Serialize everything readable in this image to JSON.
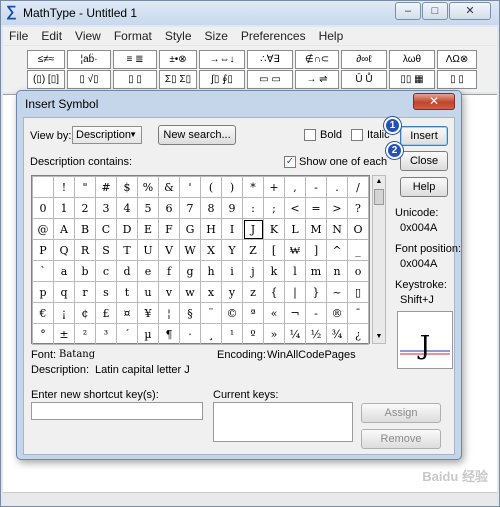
{
  "app": {
    "title": "MathType - Untitled 1",
    "window_buttons": {
      "minimize": "–",
      "maximize": "□",
      "close": "✕"
    },
    "menu": [
      "File",
      "Edit",
      "View",
      "Format",
      "Style",
      "Size",
      "Preferences",
      "Help"
    ],
    "toolbar_row1": [
      "≤≠≈",
      "¦ab̈·",
      "≡ ≣",
      "±•⊗",
      "→⇔↓",
      "∴∀∃",
      "∉∩⊂",
      "∂∞ℓ",
      "λωθ",
      "ΛΩ⊗"
    ],
    "toolbar_row2": [
      "(▯) [▯]",
      "▯ √▯",
      "▯ ▯",
      "Σ▯ Σ▯",
      "∫▯ ∮▯",
      "▭ ▭",
      "→ ⇌",
      "Ū Ů",
      "▯▯ ▦",
      "▯ ▯"
    ]
  },
  "dialog": {
    "title": "Insert Symbol",
    "close_label": "✕",
    "view_by_label": "View by:",
    "view_by_value": "Description",
    "new_search_label": "New search...",
    "bold_label": "Bold",
    "italic_label": "Italic",
    "insert_label": "Insert",
    "close_button_label": "Close",
    "help_label": "Help",
    "description_contains_label": "Description contains:",
    "show_one_label": "Show one of each",
    "show_one_checked": "✓",
    "step_badges": [
      "1",
      "2"
    ],
    "symbols": [
      [
        " ",
        "!",
        "\"",
        "#",
        "$",
        "%",
        "&",
        "'",
        "(",
        ")",
        "*",
        "+",
        ",",
        "-",
        ".",
        "/"
      ],
      [
        "0",
        "1",
        "2",
        "3",
        "4",
        "5",
        "6",
        "7",
        "8",
        "9",
        ":",
        ";",
        "<",
        "=",
        ">",
        "?"
      ],
      [
        "@",
        "A",
        "B",
        "C",
        "D",
        "E",
        "F",
        "G",
        "H",
        "I",
        "J",
        "K",
        "L",
        "M",
        "N",
        "O"
      ],
      [
        "P",
        "Q",
        "R",
        "S",
        "T",
        "U",
        "V",
        "W",
        "X",
        "Y",
        "Z",
        "[",
        "₩",
        "]",
        "^",
        "_"
      ],
      [
        "`",
        "a",
        "b",
        "c",
        "d",
        "e",
        "f",
        "g",
        "h",
        "i",
        "j",
        "k",
        "l",
        "m",
        "n",
        "o"
      ],
      [
        "p",
        "q",
        "r",
        "s",
        "t",
        "u",
        "v",
        "w",
        "x",
        "y",
        "z",
        "{",
        "|",
        "}",
        "~",
        "▯"
      ],
      [
        "€",
        "¡",
        "¢",
        "£",
        "¤",
        "¥",
        "¦",
        "§",
        "¨",
        "©",
        "ª",
        "«",
        "¬",
        "-",
        "®",
        "¯"
      ],
      [
        "°",
        "±",
        "²",
        "³",
        "´",
        "µ",
        "¶",
        "·",
        "¸",
        "¹",
        "º",
        "»",
        "¼",
        "½",
        "¾",
        "¿"
      ]
    ],
    "selected_symbol": "J",
    "unicode_label": "Unicode:",
    "unicode_value": "0x004A",
    "font_position_label": "Font position:",
    "font_position_value": "0x004A",
    "keystroke_label": "Keystroke:",
    "keystroke_value": "Shift+J",
    "font_label": "Font:",
    "font_value": "Batang",
    "encoding_label": "Encoding:",
    "encoding_value": "WinAllCodePages",
    "description_label": "Description:",
    "description_value": "Latin capital letter J",
    "shortcut_label": "Enter new shortcut key(s):",
    "current_keys_label": "Current keys:",
    "assign_label": "Assign",
    "remove_label": "Remove"
  },
  "watermark": "Baidu 经验"
}
